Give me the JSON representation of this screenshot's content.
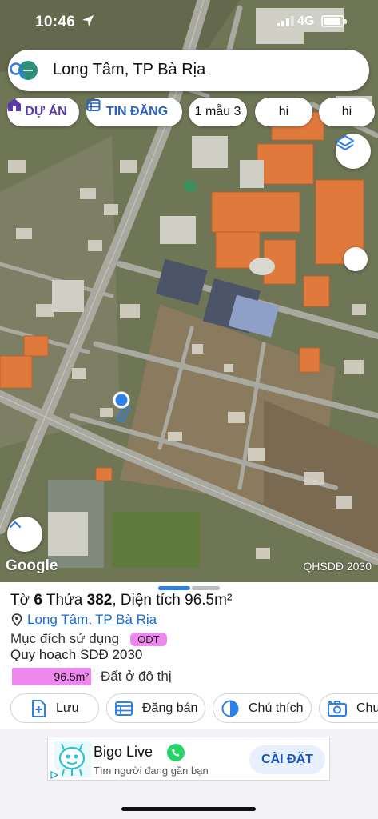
{
  "status_bar": {
    "time": "10:46",
    "network": "4G"
  },
  "search": {
    "query": "Long Tâm, TP Bà Rịa"
  },
  "chips": [
    {
      "label": "DỰ ÁN",
      "icon": "house-icon"
    },
    {
      "label": "TIN ĐĂNG",
      "icon": "calendar-icon"
    },
    {
      "label": "1 mẫu 3"
    },
    {
      "label": "hi"
    },
    {
      "label": "hi"
    }
  ],
  "map": {
    "attribution": "Google",
    "layer_label": "QHSDĐ 2030",
    "buttons": [
      "layers-icon",
      "chevron-up-icon"
    ],
    "colors": {
      "roads": "#a9a9a0",
      "rooftops": "#e07a3c",
      "location_dot": "#2f7fe8"
    }
  },
  "parcel": {
    "title_prefix": "Tờ ",
    "sheet": "6",
    "plot_label": " Thửa ",
    "plot": "382",
    "area_text": ", Diện tích 96.5m²",
    "ward": "Long Tâm",
    "separator": ",",
    "city": "TP Bà Rịa",
    "purpose_label": "Mục đích sử dụng",
    "purpose_code": "ODT",
    "plan_label": "Quy hoạch SDĐ 2030",
    "plan_area": "96.5m²",
    "plan_desc": "Đất ở đô thị",
    "plan_color": "#ee88ee"
  },
  "actions": [
    {
      "label": "Lưu",
      "icon": "add-bookmark-icon"
    },
    {
      "label": "Đăng bán",
      "icon": "listing-icon"
    },
    {
      "label": "Chú thích",
      "icon": "legend-icon"
    },
    {
      "label": "Chụp",
      "icon": "camera-icon"
    }
  ],
  "ad": {
    "title": "Bigo Live",
    "subtitle": "Tìm người đang gần bạn",
    "button": "CÀI ĐẶT"
  }
}
